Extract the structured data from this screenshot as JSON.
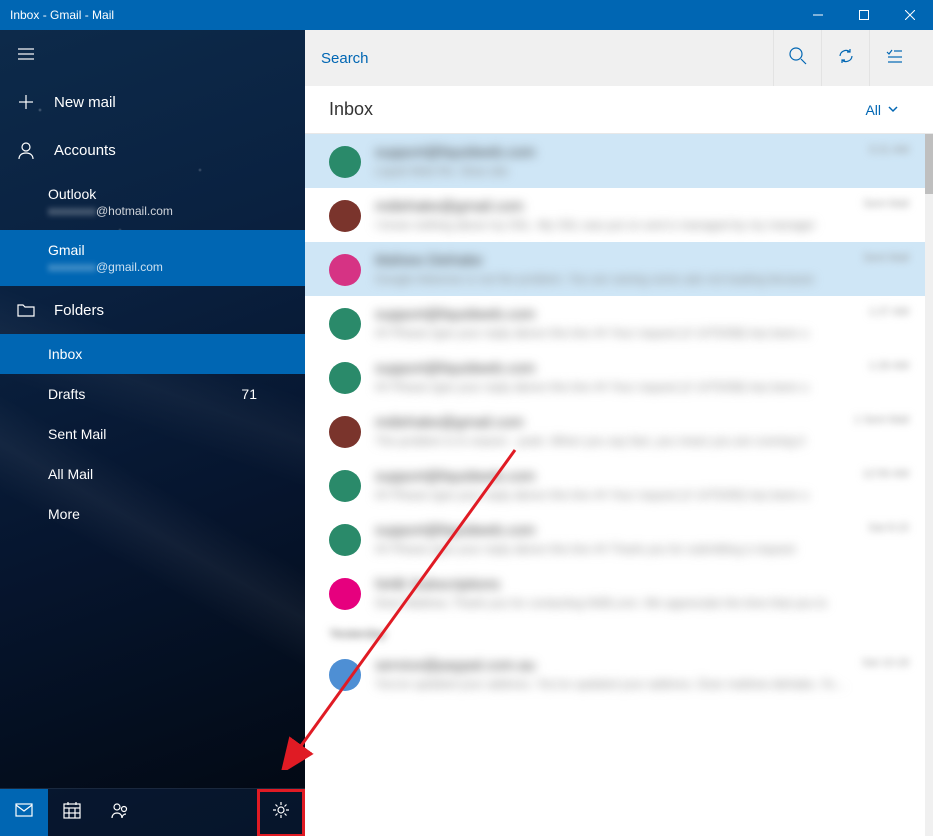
{
  "window": {
    "title": "Inbox - Gmail - Mail"
  },
  "sidebar": {
    "new_mail": "New mail",
    "accounts_label": "Accounts",
    "accounts": [
      {
        "name": "Outlook",
        "email_prefix": "xxxxxxxx",
        "email_suffix": "@hotmail.com",
        "selected": false
      },
      {
        "name": "Gmail",
        "email_prefix": "xxxxxxxx",
        "email_suffix": "@gmail.com",
        "selected": true
      }
    ],
    "folders_label": "Folders",
    "folders": [
      {
        "label": "Inbox",
        "selected": true
      },
      {
        "label": "Drafts",
        "count": "71"
      },
      {
        "label": "Sent Mail"
      },
      {
        "label": "All Mail"
      },
      {
        "label": "More"
      }
    ]
  },
  "search": {
    "placeholder": "Search"
  },
  "inbox": {
    "title": "Inbox",
    "filter_label": "All",
    "messages": [
      {
        "avatar": "#2a8a6a",
        "from": "support@liquidweb.com",
        "preview": "Liquid Web Re: Slow site",
        "meta": "3:21 AM",
        "selected": true
      },
      {
        "avatar": "#7a342c",
        "from": "mdiehake@gmail.com",
        "preview": "I know nothing about my SSL. My SSL was put on and is managed by my manager",
        "meta": "Sent Mail"
      },
      {
        "avatar": "#d63384",
        "from": "Mahew Diehake",
        "preview": "Google Adsense is not the problem. You are seeing some ads not loading because",
        "meta": "Sent Mail",
        "selected": true
      },
      {
        "avatar": "#2a8a6a",
        "from": "support@liquidweb.com",
        "preview": "## Please type your reply above this line ## Your request (# 1470338) has been u",
        "meta": "1:27 AM"
      },
      {
        "avatar": "#2a8a6a",
        "from": "support@liquidweb.com",
        "preview": "## Please type your reply above this line ## Your request (# 1470338) has been u",
        "meta": "1:26 AM"
      },
      {
        "avatar": "#7a342c",
        "from": "mdiehake@gmail.com",
        "preview": "The problem is in reason - yeah. When you say fast, you mean you are running it",
        "meta": "1  Sent Mail"
      },
      {
        "avatar": "#2a8a6a",
        "from": "support@liquidweb.com",
        "preview": "## Please type your reply above this line ## Your request (# 1470330) has been u",
        "meta": "12:56 AM"
      },
      {
        "avatar": "#2a8a6a",
        "from": "support@liquidweb.com",
        "preview": "## Please type your reply above this line ## Thank you for submitting a request",
        "meta": "Sat 8:15"
      },
      {
        "avatar": "#e6007e",
        "from": "NAB Subscriptions",
        "preview": "Dear Mathew, Thank you for contacting NAB.com. We appreciate the time that you to",
        "meta": ""
      }
    ],
    "section": "Yesterday",
    "yesterday": [
      {
        "avatar": "#4e8fd4",
        "from": "service@paypal.com.au",
        "preview": "You've updated your address. You've updated your address. Dear mathew diehake, You've",
        "meta": "Sat 10:18"
      }
    ]
  }
}
